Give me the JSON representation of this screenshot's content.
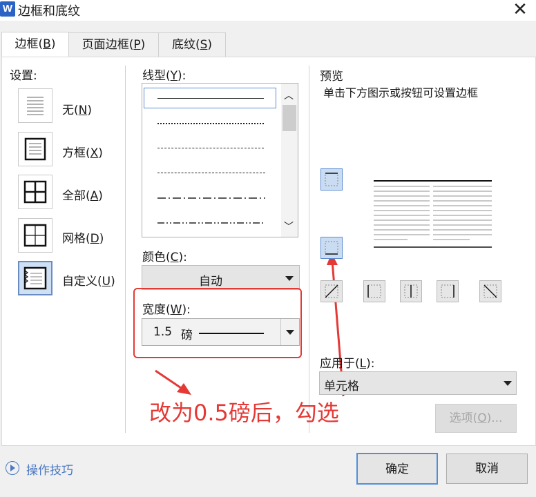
{
  "window": {
    "title": "边框和底纹",
    "app_icon": "W",
    "close": "✕"
  },
  "tabs": [
    {
      "label": "边框(",
      "key": "B",
      "tail": ")"
    },
    {
      "label": "页面边框(",
      "key": "P",
      "tail": ")"
    },
    {
      "label": "底纹(",
      "key": "S",
      "tail": ")"
    }
  ],
  "settings": {
    "heading": "设置:",
    "items": [
      {
        "label": "无(",
        "key": "N",
        "tail": ")"
      },
      {
        "label": "方框(",
        "key": "X",
        "tail": ")"
      },
      {
        "label": "全部(",
        "key": "A",
        "tail": ")"
      },
      {
        "label": "网格(",
        "key": "D",
        "tail": ")"
      },
      {
        "label": "自定义(",
        "key": "U",
        "tail": ")"
      }
    ]
  },
  "line_style": {
    "label": "线型(",
    "key": "Y",
    "tail": "):"
  },
  "color": {
    "label": "颜色(",
    "key": "C",
    "tail": "):",
    "value": "自动"
  },
  "width": {
    "label": "宽度(",
    "key": "W",
    "tail": "):",
    "value": "1.5",
    "unit": "磅"
  },
  "preview": {
    "heading": "预览",
    "hint": "单击下方图示或按钮可设置边框"
  },
  "apply_to": {
    "label": "应用于(",
    "key": "L",
    "tail": "):",
    "value": "单元格"
  },
  "options_button": {
    "label": "选项(",
    "key": "O",
    "tail": ")..."
  },
  "annotation": "改为0.5磅后，勾选",
  "tips": {
    "label": "操作技巧"
  },
  "ok_button": "确定",
  "cancel_button": "取消",
  "colors": {
    "accent": "#2b64c5",
    "annotation_red": "#e53935",
    "selection_blue": "#5b8bd1"
  }
}
